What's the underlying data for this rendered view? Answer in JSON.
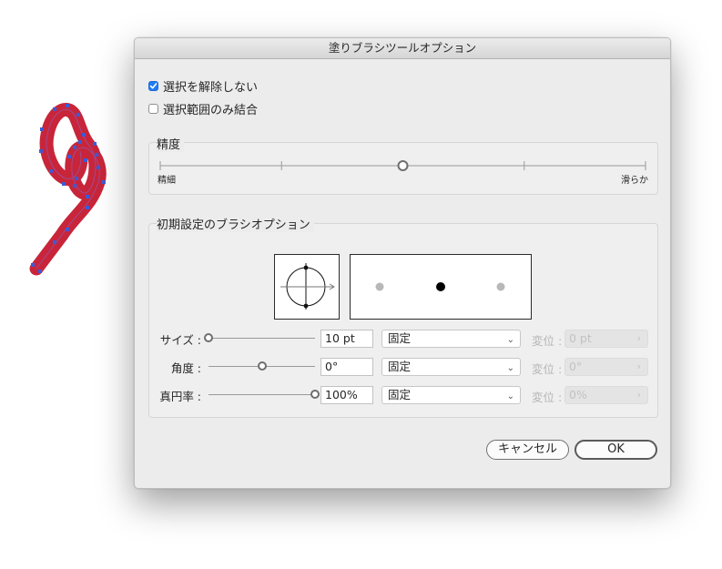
{
  "dialog": {
    "title": "塗りブラシツールオプション",
    "keep_selected": {
      "label": "選択を解除しない",
      "checked": true
    },
    "merge_only_selection": {
      "label": "選択範囲のみ結合",
      "checked": false
    }
  },
  "fidelity": {
    "label": "精度",
    "left_label": "精細",
    "right_label": "滑らか",
    "value_fraction": 0.5
  },
  "brush_defaults": {
    "label": "初期設定のブラシオプション",
    "rows": [
      {
        "label": "サイズ :",
        "value": "10 pt",
        "mode": "固定",
        "variation_label": "変位 :",
        "variation_value": "0 pt",
        "slider_fraction": 0.0
      },
      {
        "label": "角度 :",
        "value": "0°",
        "mode": "固定",
        "variation_label": "変位 :",
        "variation_value": "0°",
        "slider_fraction": 0.5
      },
      {
        "label": "真円率 :",
        "value": "100%",
        "mode": "固定",
        "variation_label": "変位 :",
        "variation_value": "0%",
        "slider_fraction": 1.0
      }
    ]
  },
  "buttons": {
    "cancel": "キャンセル",
    "ok": "OK"
  },
  "colors": {
    "accent": "#1f7cf5",
    "stroke_fill": "#c8253a",
    "anchor_points": "#3b5bd6"
  }
}
